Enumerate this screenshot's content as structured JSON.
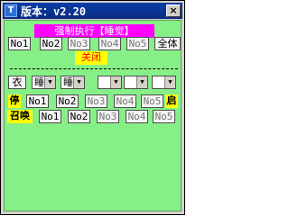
{
  "window": {
    "icon": "app-icon",
    "title": "版本：v2.20",
    "close_label": "×"
  },
  "top": {
    "banner": "强制执行【睡觉】",
    "no_buttons": [
      "No1",
      "No2",
      "No3",
      "No4",
      "No5"
    ],
    "all_label": "全体",
    "close_label": "关闭"
  },
  "row2": {
    "cloth_label": "衣",
    "select1_value": "睡",
    "select2_value": "睡",
    "select3_value": "",
    "select4_value": "",
    "select5_value": ""
  },
  "row3": {
    "stop_label": "停",
    "no_buttons": [
      "No1",
      "No2",
      "No3",
      "No4",
      "No5"
    ],
    "start_label": "启"
  },
  "row4": {
    "summon_label": "召唤",
    "no_buttons": [
      "No1",
      "No2",
      "No3",
      "No4",
      "No5"
    ]
  },
  "colors": {
    "client_bg": "#87ef87",
    "banner_bg": "#ff00ff",
    "highlight_bg": "#ffff00",
    "titlebar_bg": "#0a3ea8"
  }
}
